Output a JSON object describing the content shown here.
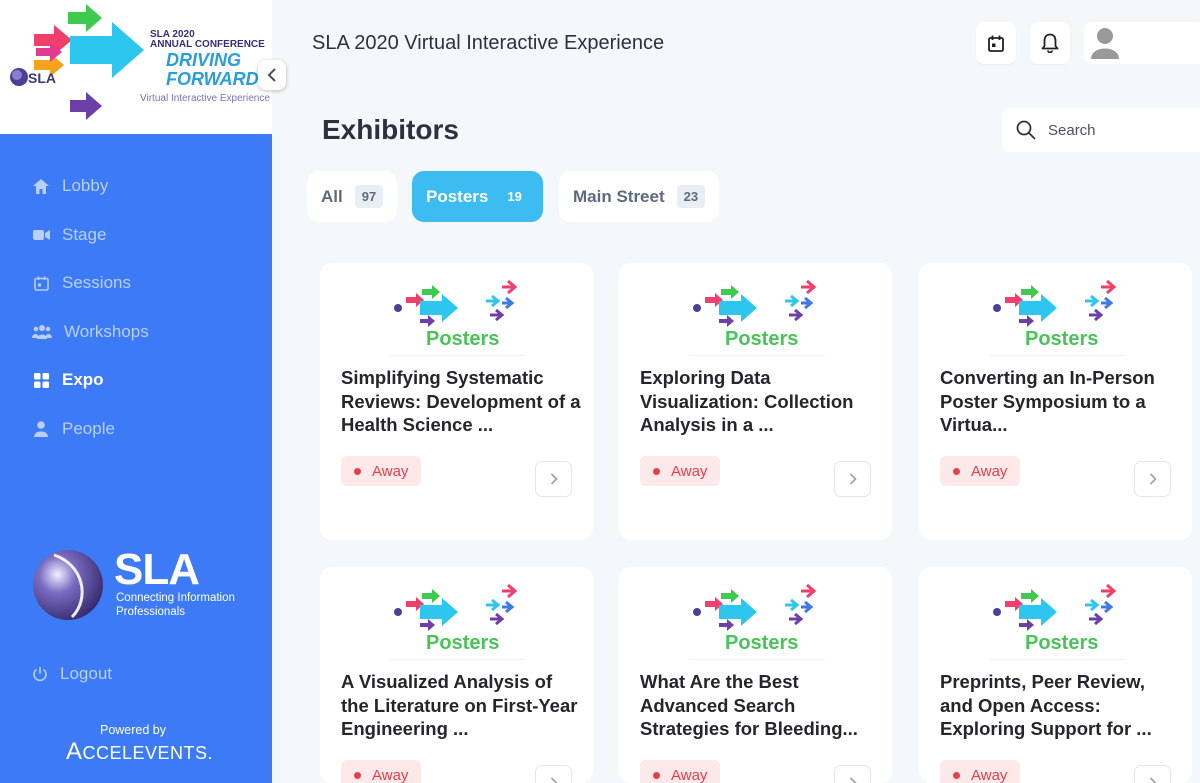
{
  "app": {
    "title": "SLA 2020 Virtual Interactive Experience"
  },
  "logo": {
    "line1": "SLA 2020",
    "line2": "ANNUAL CONFERENCE",
    "line3": "DRIVING",
    "line4": "FORWARD",
    "tagline": "Virtual Interactive Experience",
    "mini": "SLA"
  },
  "sidebar": {
    "items": [
      {
        "label": "Lobby",
        "icon": "home-icon",
        "active": false
      },
      {
        "label": "Stage",
        "icon": "video-icon",
        "active": false
      },
      {
        "label": "Sessions",
        "icon": "calendar-icon",
        "active": false
      },
      {
        "label": "Workshops",
        "icon": "group-icon",
        "active": false
      },
      {
        "label": "Expo",
        "icon": "grid-icon",
        "active": true
      },
      {
        "label": "People",
        "icon": "person-icon",
        "active": false
      }
    ],
    "brand_name": "SLA",
    "brand_line1": "Connecting Information",
    "brand_line2": "Professionals",
    "logout_label": "Logout",
    "powered_by": "Powered by",
    "accelevents_first": "A",
    "accelevents_rest": "CCELEVENTS."
  },
  "page": {
    "title": "Exhibitors"
  },
  "search": {
    "placeholder": "Search"
  },
  "filters": [
    {
      "label": "All",
      "count": "97",
      "active": false
    },
    {
      "label": "Posters",
      "count": "19",
      "active": true
    },
    {
      "label": "Main Street",
      "count": "23",
      "active": false
    }
  ],
  "cards": [
    {
      "title": "Simplifying Systematic Reviews: Development of a Health Science ...",
      "status": "Away",
      "thumb_label": "Posters"
    },
    {
      "title": "Exploring Data Visualization: Collection Analysis in a ...",
      "status": "Away",
      "thumb_label": "Posters"
    },
    {
      "title": "Converting an In-Person Poster Symposium to a Virtua...",
      "status": "Away",
      "thumb_label": "Posters"
    },
    {
      "title": "A Visualized Analysis of the Literature on First-Year Engineering ...",
      "status": "Away",
      "thumb_label": "Posters"
    },
    {
      "title": "What Are the Best Advanced Search Strategies for Bleeding...",
      "status": "Away",
      "thumb_label": "Posters"
    },
    {
      "title": "Preprints, Peer Review, and Open Access: Exploring Support for ...",
      "status": "Away",
      "thumb_label": "Posters"
    }
  ],
  "colors": {
    "sidebar": "#3d7af5",
    "active_filter": "#3cbcf0",
    "away": "#e5404a",
    "posters_green": "#49c458"
  }
}
